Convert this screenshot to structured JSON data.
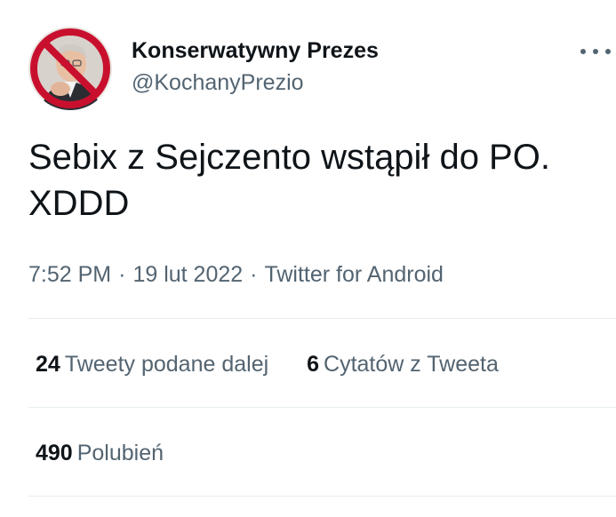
{
  "tweet": {
    "author": {
      "display_name": "Konserwatywny Prezes",
      "handle": "@KochanyPrezio",
      "avatar_icon": "no-sign-portrait-avatar"
    },
    "text": "Sebix z Sejczento wstąpił do PO.\nXDDD",
    "time": "7:52 PM",
    "date": "19 lut 2022",
    "separator": "·",
    "source": "Twitter for Android",
    "more_icon": "more-options-icon"
  },
  "stats": {
    "retweets": {
      "count": "24",
      "label": "Tweety podane dalej"
    },
    "quotes": {
      "count": "6",
      "label": "Cytatów z Tweeta"
    },
    "likes": {
      "count": "490",
      "label": "Polubień"
    }
  },
  "colors": {
    "text_primary": "#0f1419",
    "text_secondary": "#536471",
    "divider": "#e6ecf0",
    "avatar_ring": "#c8102e"
  }
}
